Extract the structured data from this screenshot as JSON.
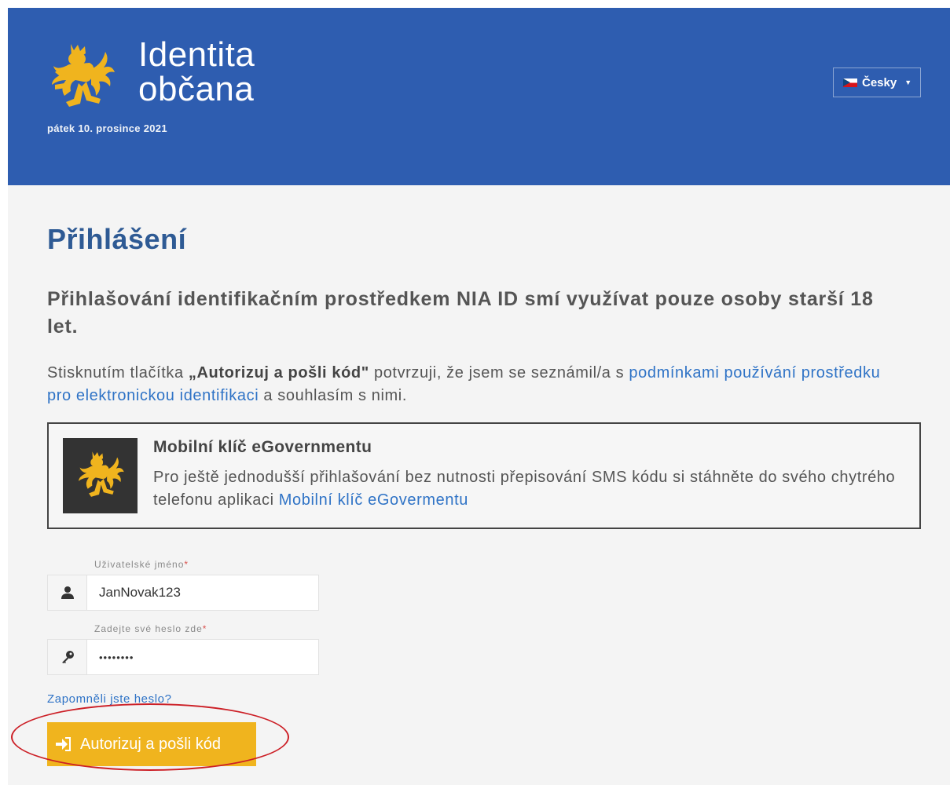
{
  "header": {
    "logo_line1": "Identita",
    "logo_line2": "občana",
    "date": "pátek 10. prosince 2021",
    "language": "Česky",
    "background_color": "#2e5db0"
  },
  "main": {
    "title": "Přihlášení",
    "notice": "Přihlašování identifikačním prostředkem NIA ID smí využívat pouze osoby starší 18 let.",
    "terms": {
      "before": "Stisknutím tlačítka",
      "button_quote": "„Autorizuj a pošli kód\"",
      "middle": " potvrzuji, že jsem se seznámil/a s ",
      "link": "podmínkami používání prostředku pro elektronickou identifikaci",
      "after": " a souhlasím s nimi."
    },
    "mobile_key": {
      "title": "Mobilní klíč eGovernmentu",
      "text": "Pro ještě jednodušší přihlašování bez nutnosti přepisování SMS kódu si stáhněte do svého chytrého telefonu aplikaci ",
      "link": "Mobilní klíč eGovermentu"
    }
  },
  "form": {
    "username_label": "Uživatelské jméno",
    "username_value": "JanNovak123",
    "password_label": "Zadejte své heslo zde",
    "password_value": "••••••••",
    "required_mark": "*",
    "forgot_link": "Zapomněli jste heslo?",
    "submit_label": "Autorizuj a pošli kód",
    "submit_color": "#f0b41e",
    "highlight_color": "#cc1f26"
  },
  "icons": {
    "logo": "lion-crest-icon",
    "flag": "czech-flag-icon",
    "dropdown": "caret-down-icon",
    "user": "user-icon",
    "password": "key-icon",
    "submit": "sign-in-icon"
  }
}
